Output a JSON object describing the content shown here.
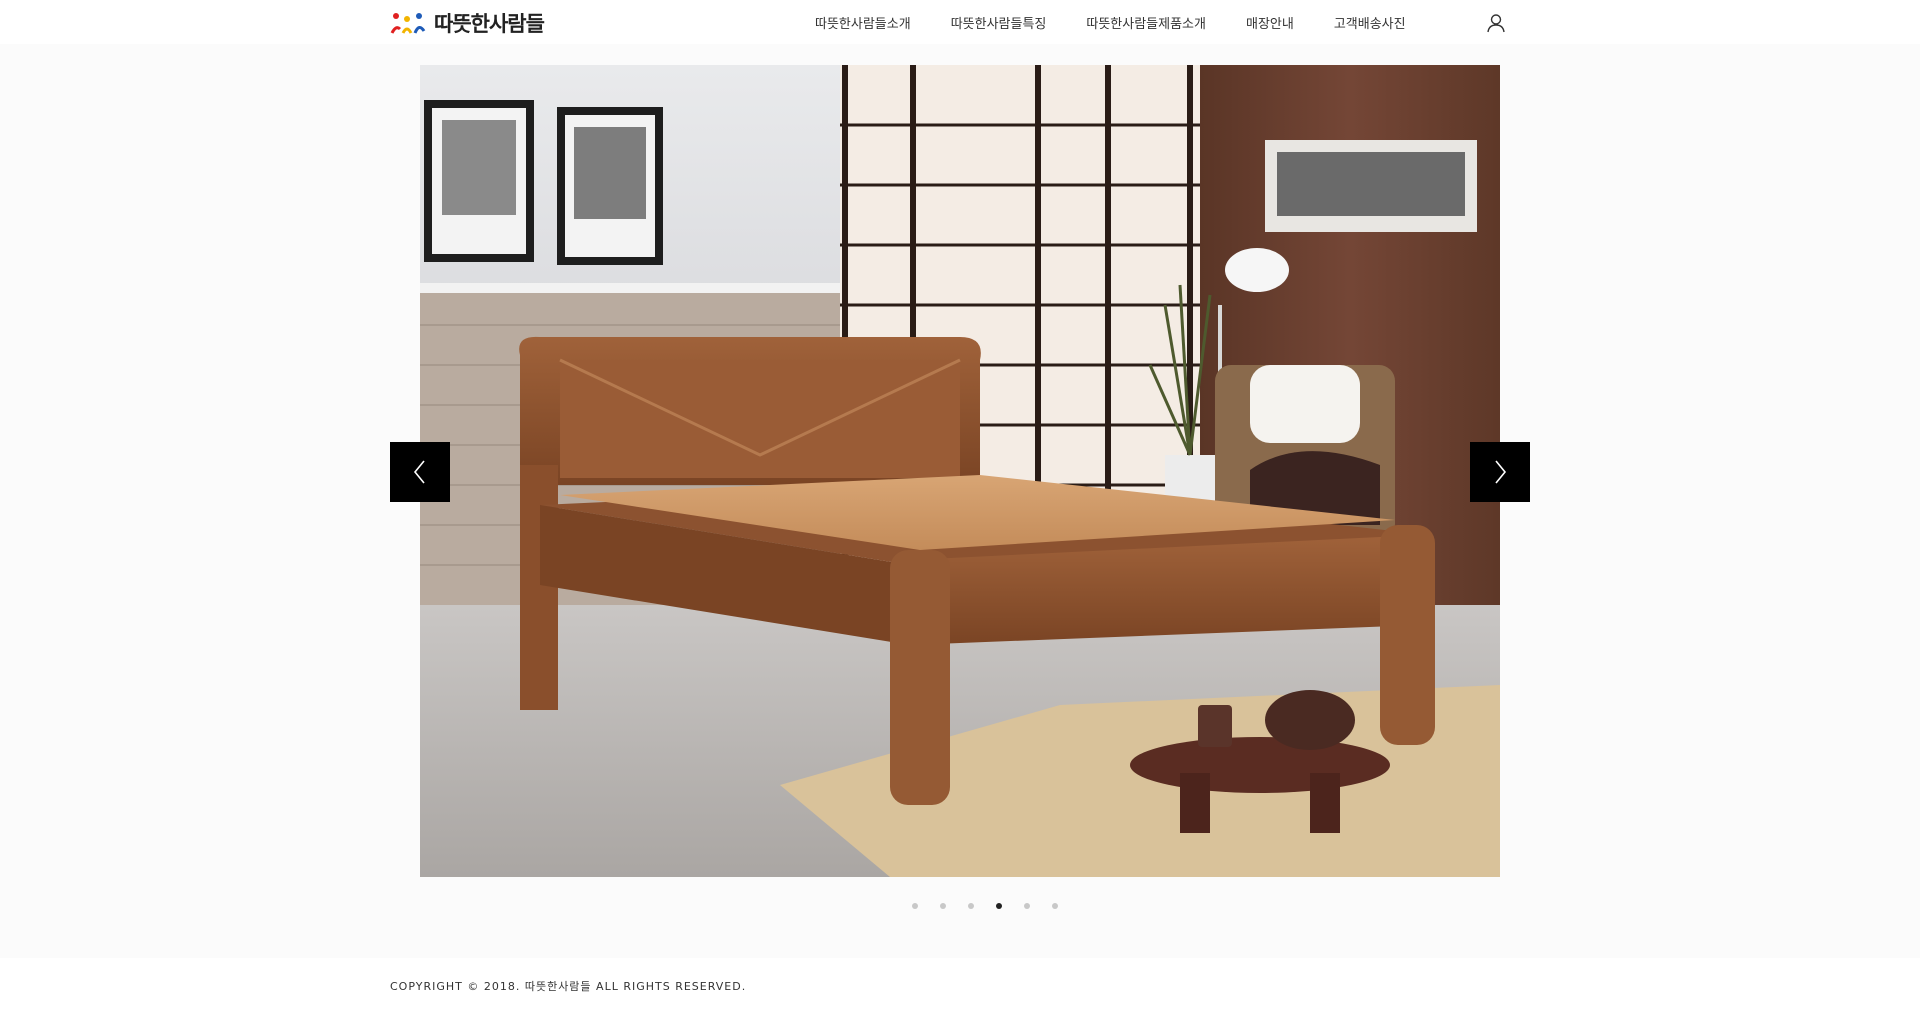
{
  "header": {
    "logo_text": "따뜻한사람들",
    "nav": [
      {
        "label": "따뜻한사람들소개"
      },
      {
        "label": "따뜻한사람들특징"
      },
      {
        "label": "따뜻한사람들제품소개"
      },
      {
        "label": "매장안내"
      },
      {
        "label": "고객배송사진"
      }
    ],
    "user_icon": "user-icon"
  },
  "slider": {
    "prev_icon": "chevron-left-icon",
    "next_icon": "chevron-right-icon",
    "slide_count": 6,
    "active_index": 3
  },
  "footer": {
    "copyright": "COPYRIGHT © 2018. 따뜻한사람들 ALL RIGHTS RESERVED."
  },
  "colors": {
    "arrow_bg": "#000000",
    "dot_active": "#222222",
    "dot_inactive": "#c8c8c8",
    "logo_red": "#e02020",
    "logo_yellow": "#f2b400",
    "logo_blue": "#1e5bb8"
  }
}
